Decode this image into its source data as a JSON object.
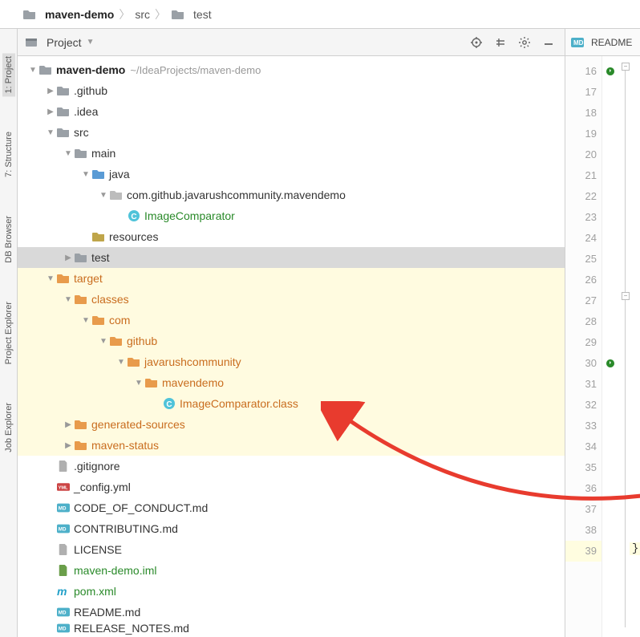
{
  "breadcrumb": {
    "root": "maven-demo",
    "mid": "src",
    "leaf": "test"
  },
  "leftRail": {
    "project": "1: Project",
    "structure": "7: Structure",
    "dbBrowser": "DB Browser",
    "projectExplorer": "Project Explorer",
    "jobExplorer": "Job Explorer"
  },
  "toolbar": {
    "selector": "Project"
  },
  "rightPanel": {
    "openFile": "README",
    "lineStart": 16,
    "lineEnd": 39,
    "highlightLine": 39
  },
  "tree": [
    {
      "indent": 0,
      "arrow": "down",
      "icon": "folder-gray",
      "label": "maven-demo",
      "path": "~/IdeaProjects/maven-demo",
      "bold": true
    },
    {
      "indent": 1,
      "arrow": "right",
      "icon": "folder-gray",
      "label": ".github"
    },
    {
      "indent": 1,
      "arrow": "right",
      "icon": "folder-gray",
      "label": ".idea"
    },
    {
      "indent": 1,
      "arrow": "down",
      "icon": "folder-gray",
      "label": "src"
    },
    {
      "indent": 2,
      "arrow": "down",
      "icon": "folder-gray",
      "label": "main"
    },
    {
      "indent": 3,
      "arrow": "down",
      "icon": "folder-blue",
      "label": "java"
    },
    {
      "indent": 4,
      "arrow": "down",
      "icon": "folder-pkg",
      "label": "com.github.javarushcommunity.mavendemo"
    },
    {
      "indent": 5,
      "arrow": "none",
      "icon": "class-c",
      "label": "ImageComparator",
      "labelClass": "green"
    },
    {
      "indent": 3,
      "arrow": "none",
      "icon": "folder-res",
      "label": "resources"
    },
    {
      "indent": 2,
      "arrow": "right",
      "icon": "folder-gray",
      "label": "test",
      "selected": true
    },
    {
      "indent": 1,
      "arrow": "down",
      "icon": "folder-orange",
      "label": "target",
      "labelClass": "orange",
      "hl": true
    },
    {
      "indent": 2,
      "arrow": "down",
      "icon": "folder-orange",
      "label": "classes",
      "labelClass": "orange",
      "hl": true
    },
    {
      "indent": 3,
      "arrow": "down",
      "icon": "folder-orange",
      "label": "com",
      "labelClass": "orange",
      "hl": true
    },
    {
      "indent": 4,
      "arrow": "down",
      "icon": "folder-orange",
      "label": "github",
      "labelClass": "orange",
      "hl": true
    },
    {
      "indent": 5,
      "arrow": "down",
      "icon": "folder-orange",
      "label": "javarushcommunity",
      "labelClass": "orange",
      "hl": true
    },
    {
      "indent": 6,
      "arrow": "down",
      "icon": "folder-orange",
      "label": "mavendemo",
      "labelClass": "orange",
      "hl": true
    },
    {
      "indent": 7,
      "arrow": "none",
      "icon": "class-c",
      "label": "ImageComparator.class",
      "labelClass": "orange",
      "hl": true
    },
    {
      "indent": 2,
      "arrow": "right",
      "icon": "folder-orange",
      "label": "generated-sources",
      "labelClass": "orange",
      "hl": true
    },
    {
      "indent": 2,
      "arrow": "right",
      "icon": "folder-orange",
      "label": "maven-status",
      "labelClass": "orange",
      "hl": true
    },
    {
      "indent": 1,
      "arrow": "none",
      "icon": "file-gray",
      "label": ".gitignore"
    },
    {
      "indent": 1,
      "arrow": "none",
      "icon": "file-yml",
      "label": "_config.yml"
    },
    {
      "indent": 1,
      "arrow": "none",
      "icon": "file-md",
      "label": "CODE_OF_CONDUCT.md"
    },
    {
      "indent": 1,
      "arrow": "none",
      "icon": "file-md",
      "label": "CONTRIBUTING.md"
    },
    {
      "indent": 1,
      "arrow": "none",
      "icon": "file-gray",
      "label": "LICENSE"
    },
    {
      "indent": 1,
      "arrow": "none",
      "icon": "file-iml",
      "label": "maven-demo.iml",
      "labelClass": "green"
    },
    {
      "indent": 1,
      "arrow": "none",
      "icon": "file-pom",
      "label": "pom.xml",
      "labelClass": "green"
    },
    {
      "indent": 1,
      "arrow": "none",
      "icon": "file-md",
      "label": "README.md"
    },
    {
      "indent": 1,
      "arrow": "none",
      "icon": "file-md",
      "label": "RELEASE_NOTES.md",
      "cut": true
    }
  ]
}
